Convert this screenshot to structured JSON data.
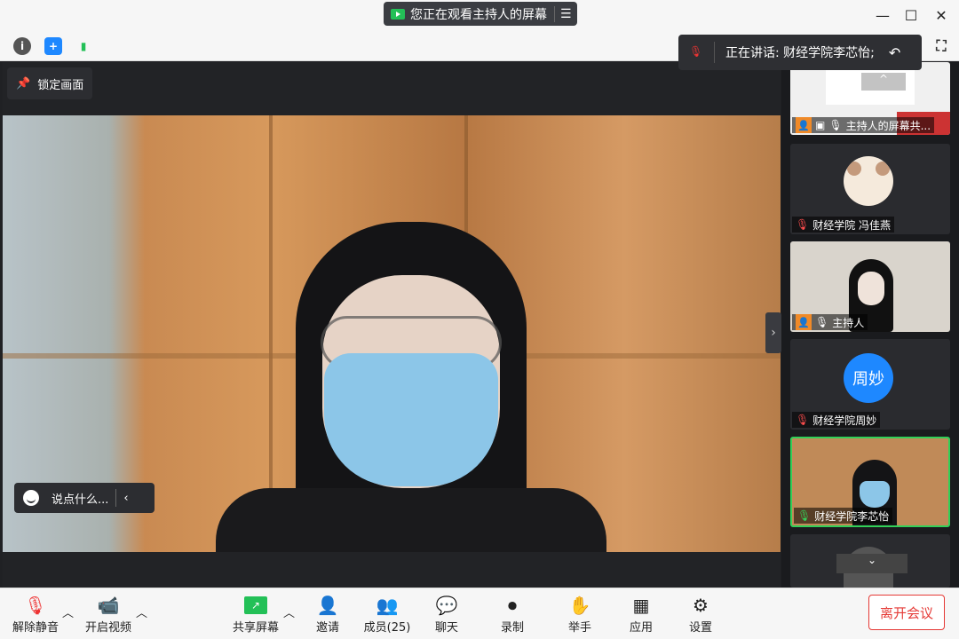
{
  "title_banner": {
    "text": "您正在观看主持人的屏幕"
  },
  "window_controls": {
    "minimize": "—",
    "maximize": "☐",
    "close": "✕"
  },
  "speaking_indicator": {
    "text": "正在讲话: 财经学院李芯怡;"
  },
  "pin_button": {
    "label": "锁定画面"
  },
  "chat_input": {
    "placeholder": "说点什么..."
  },
  "participants": [
    {
      "name": "主持人的屏幕共...",
      "muted": false,
      "host": true
    },
    {
      "name": "财经学院 冯佳燕",
      "muted": true
    },
    {
      "name": "主持人",
      "muted": false,
      "host": true
    },
    {
      "name": "财经学院周妙",
      "muted": true,
      "avatar_text": "周妙"
    },
    {
      "name": "财经学院李芯怡",
      "muted": false,
      "speaking": true
    }
  ],
  "toolbar": {
    "unmute": "解除静音",
    "start_video": "开启视频",
    "share_screen": "共享屏幕",
    "invite": "邀请",
    "members": "成员(25)",
    "chat": "聊天",
    "record": "录制",
    "raise_hand": "举手",
    "apps": "应用",
    "settings": "设置",
    "leave": "离开会议"
  },
  "colors": {
    "accent": "#1e88ff",
    "leave": "#e53935",
    "mic_active": "#32d058"
  }
}
